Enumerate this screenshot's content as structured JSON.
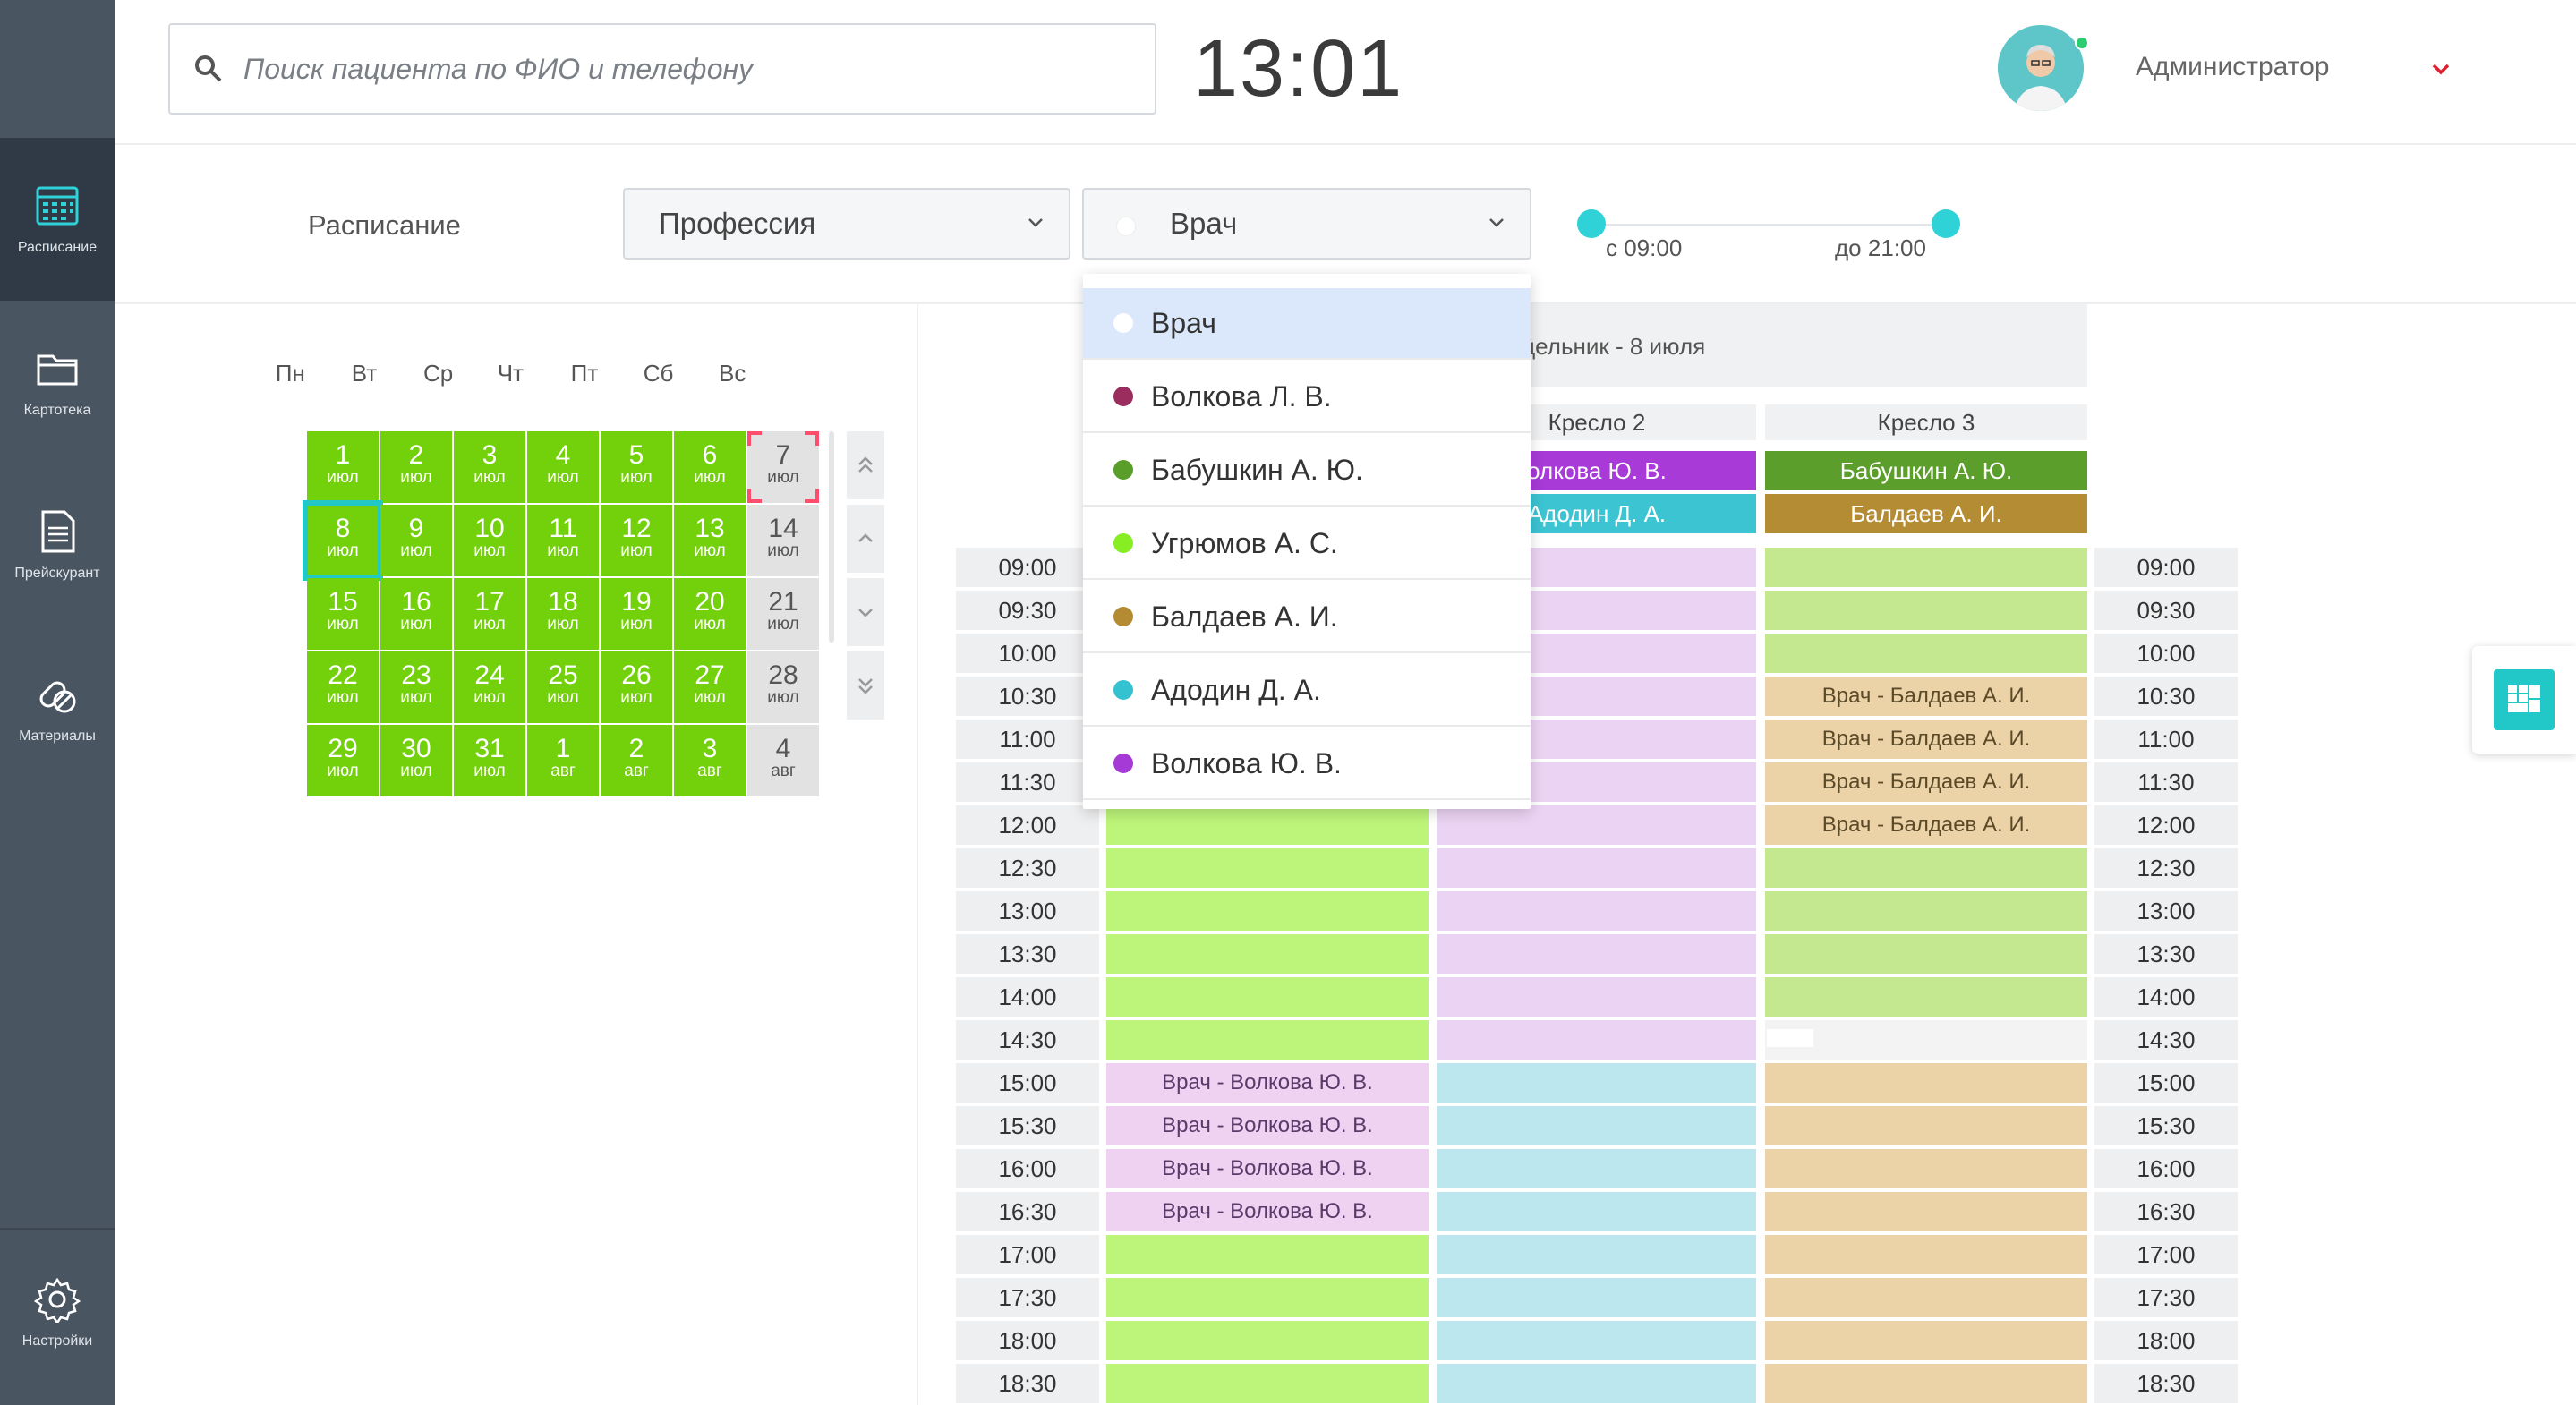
{
  "sidebar": {
    "items": [
      {
        "label": "Расписание",
        "icon": "calendar-icon"
      },
      {
        "label": "Картотека",
        "icon": "folder-icon"
      },
      {
        "label": "Прейскурант",
        "icon": "document-icon"
      },
      {
        "label": "Материалы",
        "icon": "pills-icon"
      }
    ],
    "settings": {
      "label": "Настройки",
      "icon": "gear-icon"
    }
  },
  "header": {
    "search_placeholder": "Поиск пациента по ФИО и телефону",
    "clock": "13:01",
    "user": "Администратор"
  },
  "toolbar": {
    "title": "Расписание",
    "profession": "Профессия",
    "doctor": "Врач",
    "range_from": "с 09:00",
    "range_to": "до 21:00"
  },
  "calendar": {
    "days_of_week": [
      "Пн",
      "Вт",
      "Ср",
      "Чт",
      "Пт",
      "Сб",
      "Вс"
    ],
    "weeks": [
      [
        [
          "1",
          "июл"
        ],
        [
          "2",
          "июл"
        ],
        [
          "3",
          "июл"
        ],
        [
          "4",
          "июл"
        ],
        [
          "5",
          "июл"
        ],
        [
          "6",
          "июл"
        ],
        [
          "7",
          "июл"
        ]
      ],
      [
        [
          "8",
          "июл"
        ],
        [
          "9",
          "июл"
        ],
        [
          "10",
          "июл"
        ],
        [
          "11",
          "июл"
        ],
        [
          "12",
          "июл"
        ],
        [
          "13",
          "июл"
        ],
        [
          "14",
          "июл"
        ]
      ],
      [
        [
          "15",
          "июл"
        ],
        [
          "16",
          "июл"
        ],
        [
          "17",
          "июл"
        ],
        [
          "18",
          "июл"
        ],
        [
          "19",
          "июл"
        ],
        [
          "20",
          "июл"
        ],
        [
          "21",
          "июл"
        ]
      ],
      [
        [
          "22",
          "июл"
        ],
        [
          "23",
          "июл"
        ],
        [
          "24",
          "июл"
        ],
        [
          "25",
          "июл"
        ],
        [
          "26",
          "июл"
        ],
        [
          "27",
          "июл"
        ],
        [
          "28",
          "июл"
        ]
      ],
      [
        [
          "29",
          "июл"
        ],
        [
          "30",
          "июл"
        ],
        [
          "31",
          "июл"
        ],
        [
          "1",
          "авг"
        ],
        [
          "2",
          "авг"
        ],
        [
          "3",
          "авг"
        ],
        [
          "4",
          "авг"
        ]
      ]
    ],
    "selected": "8"
  },
  "schedule": {
    "day_title": "дельник - 8 июля",
    "chairs": [
      "Кресло 2",
      "Кресло 3"
    ],
    "chair2_doctors": [
      "олкова Ю. В.",
      "Адодин Д. А."
    ],
    "chair3_doctors": [
      "Бабушкин А. Ю.",
      "Балдаев А. И."
    ],
    "times": [
      "09:00",
      "09:30",
      "10:00",
      "10:30",
      "11:00",
      "11:30",
      "12:00",
      "12:30",
      "13:00",
      "13:30",
      "14:00",
      "14:30",
      "15:00",
      "15:30",
      "16:00",
      "16:30",
      "17:00",
      "17:30",
      "18:00",
      "18:30"
    ],
    "slot_baldaev": "Врач - Балдаев А. И.",
    "slot_volkova": "Врач - Волкова Ю. В."
  },
  "dropdown": {
    "options": [
      {
        "label": "Врач",
        "color": "#ffffff"
      },
      {
        "label": "Волкова Л. В.",
        "color": "#9b2d5e"
      },
      {
        "label": "Бабушкин А. Ю.",
        "color": "#5a9e2a"
      },
      {
        "label": "Угрюмов А. С.",
        "color": "#86ee22"
      },
      {
        "label": "Балдаев А. И.",
        "color": "#b48b32"
      },
      {
        "label": "Адодин Д. А.",
        "color": "#35c2d0"
      },
      {
        "label": "Волкова Ю. В.",
        "color": "#a63ad6"
      }
    ]
  },
  "colors": {
    "accent": "#22c7c7",
    "calendar_green": "#72d10a",
    "sidebar": "#4a5562"
  }
}
